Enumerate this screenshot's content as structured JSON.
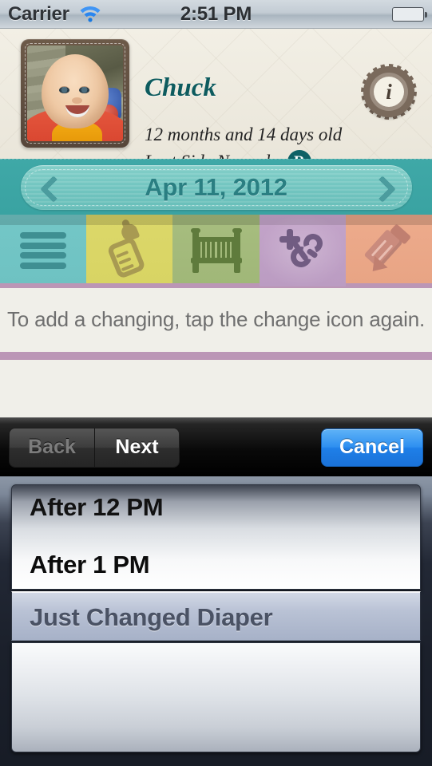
{
  "status_bar": {
    "carrier": "Carrier",
    "time": "2:51 PM",
    "wifi_icon": "wifi-icon",
    "battery_icon": "battery-icon"
  },
  "header": {
    "baby_name": "Chuck",
    "age": "12 months and 14 days old",
    "last_side_label": "Last Side Nursed:",
    "last_side_value": "R",
    "info_icon": "info-icon",
    "photo_alt": "baby-photo"
  },
  "date_bar": {
    "date": "Apr 11, 2012",
    "prev_icon": "chevron-left-icon",
    "next_icon": "chevron-right-icon"
  },
  "tabs": [
    {
      "name": "summary",
      "icon": "list-icon",
      "active": false
    },
    {
      "name": "feeding",
      "icon": "baby-bottle-icon",
      "active": false
    },
    {
      "name": "sleep",
      "icon": "crib-icon",
      "active": false
    },
    {
      "name": "change",
      "icon": "safety-pin-plus-icon",
      "active": true
    },
    {
      "name": "notes",
      "icon": "pencil-icon",
      "active": false
    }
  ],
  "content": {
    "instruction": "To add a changing, tap the change icon again."
  },
  "accessory_toolbar": {
    "back_label": "Back",
    "next_label": "Next",
    "cancel_label": "Cancel",
    "back_disabled": true
  },
  "picker": {
    "rows_above": [
      "After 12 PM",
      "After 1 PM"
    ],
    "selected": "Just Changed Diaper",
    "rows_below": [
      ""
    ]
  },
  "colors": {
    "accent_teal": "#0e6166",
    "tab_active_purple": "#bb9cc2",
    "divider_mauve": "#bb96b6",
    "cancel_blue": "#2e8ff0",
    "paper": "#f0efe9"
  }
}
